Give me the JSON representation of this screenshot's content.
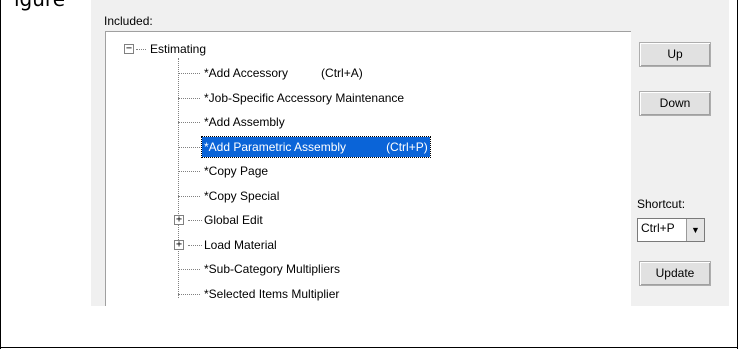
{
  "document": {
    "partial_text": "igure"
  },
  "dialog": {
    "included_label": "Included:",
    "tree": {
      "root": "Estimating",
      "items": [
        {
          "label": "*Add Accessory",
          "shortcut": "(Ctrl+A)",
          "expandable": false,
          "selected": false
        },
        {
          "label": "*Job-Specific Accessory Maintenance",
          "shortcut": "",
          "expandable": false,
          "selected": false
        },
        {
          "label": "*Add Assembly",
          "shortcut": "",
          "expandable": false,
          "selected": false
        },
        {
          "label": "*Add Parametric Assembly",
          "shortcut": "(Ctrl+P)",
          "expandable": false,
          "selected": true
        },
        {
          "label": "*Copy Page",
          "shortcut": "",
          "expandable": false,
          "selected": false
        },
        {
          "label": "*Copy Special",
          "shortcut": "",
          "expandable": false,
          "selected": false
        },
        {
          "label": "Global Edit",
          "shortcut": "",
          "expandable": true,
          "selected": false
        },
        {
          "label": "Load Material",
          "shortcut": "",
          "expandable": true,
          "selected": false
        },
        {
          "label": "*Sub-Category Multipliers",
          "shortcut": "",
          "expandable": false,
          "selected": false
        },
        {
          "label": "*Selected Items Multiplier",
          "shortcut": "",
          "expandable": false,
          "selected": false
        }
      ]
    },
    "buttons": {
      "up": "Up",
      "down": "Down",
      "update": "Update"
    },
    "shortcut": {
      "label": "Shortcut:",
      "value": "Ctrl+P"
    },
    "icons": {
      "collapse": "minus-box-icon",
      "expand": "plus-box-icon",
      "dropdown": "chevron-down-icon"
    },
    "colors": {
      "selection": "#0a64d8",
      "dialog_bg": "#f0f0f0"
    }
  }
}
